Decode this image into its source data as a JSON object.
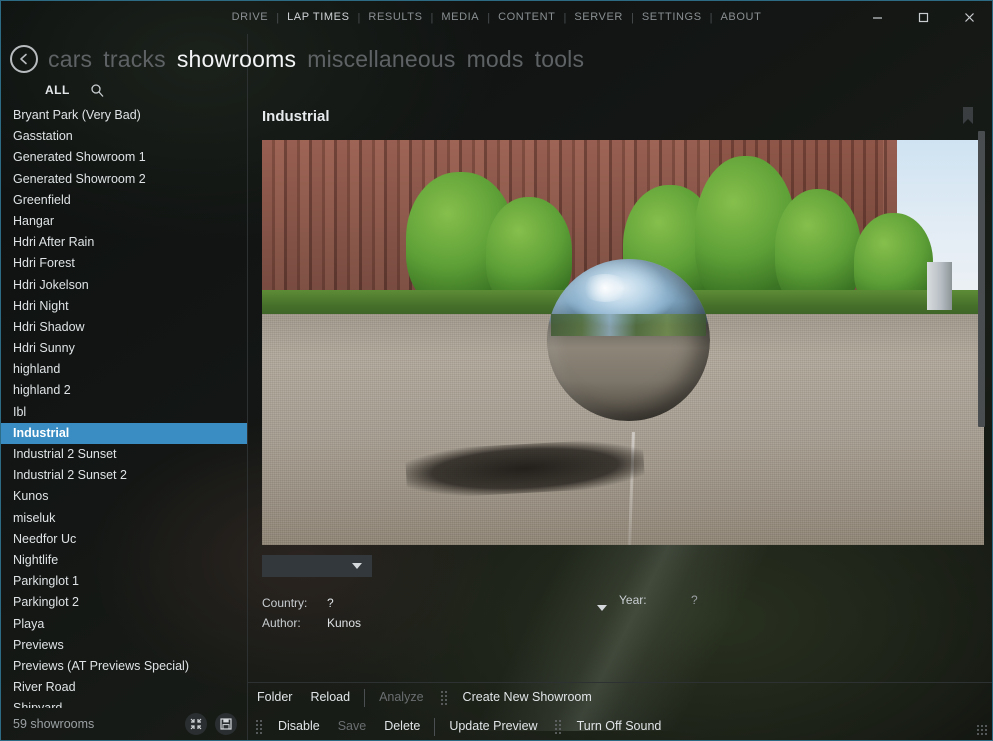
{
  "window": {
    "controls": [
      {
        "name": "minimize",
        "glyph": "minimize-icon"
      },
      {
        "name": "maximize",
        "glyph": "maximize-icon"
      },
      {
        "name": "close",
        "glyph": "close-icon"
      }
    ],
    "accent_color": "#3a8dc2",
    "border_color": "#2d6a84",
    "background_color": "#141414"
  },
  "top_menu": {
    "items": [
      {
        "label": "DRIVE",
        "active": false
      },
      {
        "label": "LAP TIMES",
        "active": true
      },
      {
        "label": "RESULTS",
        "active": false
      },
      {
        "label": "MEDIA",
        "active": false
      },
      {
        "label": "CONTENT",
        "active": false
      },
      {
        "label": "SERVER",
        "active": false
      },
      {
        "label": "SETTINGS",
        "active": false
      },
      {
        "label": "ABOUT",
        "active": false
      }
    ],
    "separator": "|"
  },
  "nav": {
    "back_icon": "back-arrow-icon",
    "items": [
      {
        "label": "cars",
        "active": false
      },
      {
        "label": "tracks",
        "active": false
      },
      {
        "label": "showrooms",
        "active": true
      },
      {
        "label": "miscellaneous",
        "active": false
      },
      {
        "label": "mods",
        "active": false
      },
      {
        "label": "tools",
        "active": false
      }
    ]
  },
  "filter": {
    "all_label": "ALL",
    "search_icon": "search-icon"
  },
  "sidebar": {
    "items": [
      {
        "label": "Bryant Park (Very Bad)",
        "selected": false
      },
      {
        "label": "Gasstation",
        "selected": false
      },
      {
        "label": "Generated Showroom 1",
        "selected": false
      },
      {
        "label": "Generated Showroom 2",
        "selected": false
      },
      {
        "label": "Greenfield",
        "selected": false
      },
      {
        "label": "Hangar",
        "selected": false
      },
      {
        "label": "Hdri After Rain",
        "selected": false
      },
      {
        "label": "Hdri Forest",
        "selected": false
      },
      {
        "label": "Hdri Jokelson",
        "selected": false
      },
      {
        "label": "Hdri Night",
        "selected": false
      },
      {
        "label": "Hdri Shadow",
        "selected": false
      },
      {
        "label": "Hdri Sunny",
        "selected": false
      },
      {
        "label": "highland",
        "selected": false
      },
      {
        "label": "highland 2",
        "selected": false
      },
      {
        "label": "Ibl",
        "selected": false
      },
      {
        "label": "Industrial",
        "selected": true
      },
      {
        "label": "Industrial 2 Sunset",
        "selected": false
      },
      {
        "label": "Industrial 2 Sunset 2",
        "selected": false
      },
      {
        "label": "Kunos",
        "selected": false
      },
      {
        "label": "miseluk",
        "selected": false
      },
      {
        "label": "Needfor Uc",
        "selected": false
      },
      {
        "label": "Nightlife",
        "selected": false
      },
      {
        "label": "Parkinglot 1",
        "selected": false
      },
      {
        "label": "Parkinglot 2",
        "selected": false
      },
      {
        "label": "Playa",
        "selected": false
      },
      {
        "label": "Previews",
        "selected": false
      },
      {
        "label": "Previews (AT Previews Special)",
        "selected": false
      },
      {
        "label": "River Road",
        "selected": false
      },
      {
        "label": "Shipyard",
        "selected": false
      }
    ]
  },
  "status": {
    "count_text": "59 showrooms",
    "icons": [
      {
        "name": "collapse-icon"
      },
      {
        "name": "save-icon"
      }
    ]
  },
  "detail": {
    "title": "Industrial",
    "bookmark_icon": "bookmark-icon",
    "preview_alt": "chrome-sphere-industrial-preview",
    "dropdown_value": "",
    "fields": [
      {
        "label": "Country:",
        "value": "?"
      },
      {
        "label": "Author:",
        "value": "Kunos"
      }
    ],
    "year_label": "Year:",
    "year_value": "?"
  },
  "toolbar": {
    "row1": [
      {
        "type": "button",
        "label": "Folder",
        "disabled": false
      },
      {
        "type": "button",
        "label": "Reload",
        "disabled": false
      },
      {
        "type": "separator"
      },
      {
        "type": "button",
        "label": "Analyze",
        "disabled": true
      },
      {
        "type": "grip"
      },
      {
        "type": "button",
        "label": "Create New Showroom",
        "disabled": false
      }
    ],
    "row2": [
      {
        "type": "grip"
      },
      {
        "type": "button",
        "label": "Disable",
        "disabled": false
      },
      {
        "type": "button",
        "label": "Save",
        "disabled": true
      },
      {
        "type": "button",
        "label": "Delete",
        "disabled": false
      },
      {
        "type": "separator"
      },
      {
        "type": "button",
        "label": "Update Preview",
        "disabled": false
      },
      {
        "type": "grip"
      },
      {
        "type": "button",
        "label": "Turn Off Sound",
        "disabled": false
      }
    ]
  }
}
